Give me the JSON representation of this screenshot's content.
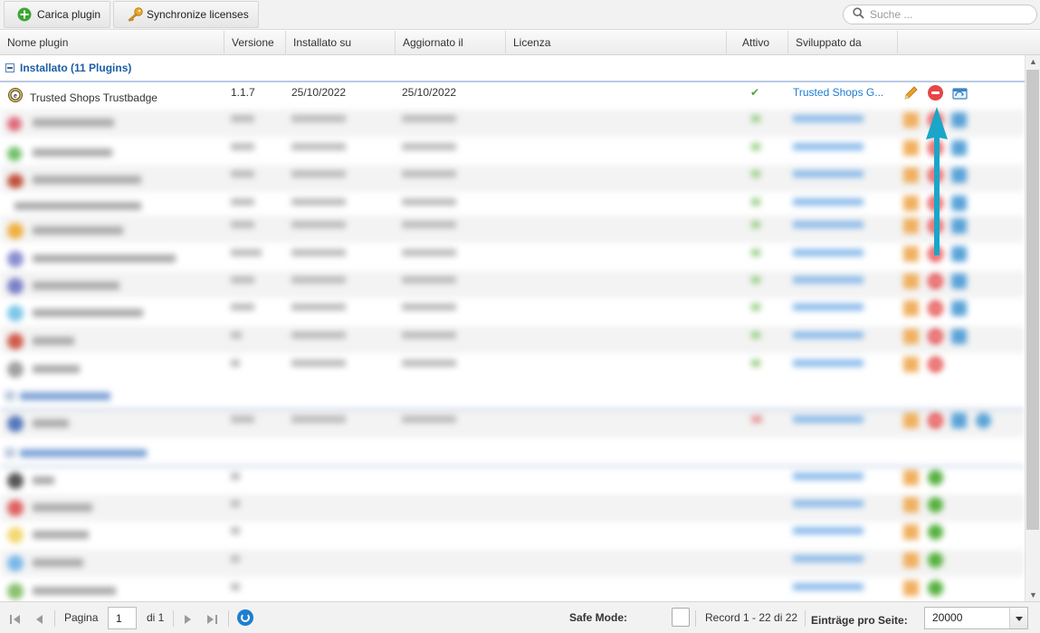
{
  "toolbar": {
    "upload_label": "Carica plugin",
    "sync_label": "Synchronize licenses",
    "search_placeholder": "Suche ..."
  },
  "columns": {
    "name": "Nome plugin",
    "version": "Versione",
    "installed": "Installato su",
    "updated": "Aggiornato il",
    "license": "Licenza",
    "active": "Attivo",
    "developer": "Sviluppato da"
  },
  "group": {
    "label": "Installato (11 Plugins)"
  },
  "first_row": {
    "name": "Trusted Shops Trustbadge",
    "version": "1.1.7",
    "installed": "25/10/2022",
    "updated": "25/10/2022",
    "active": "✔",
    "developer": "Trusted Shops G..."
  },
  "pager": {
    "page_label": "Pagina",
    "page_value": "1",
    "of_label": "di 1",
    "safe_mode_label": "Safe Mode:",
    "record_label": "Record 1 - 22 di 22",
    "per_page_label": "Einträge pro Seite:",
    "per_page_value": "20000"
  },
  "icons": {
    "add": "plus-circle-icon",
    "key": "key-icon",
    "search": "search-icon",
    "edit": "pencil-icon",
    "uninstall": "stop-icon",
    "update": "update-icon",
    "refresh": "refresh-icon"
  },
  "colors": {
    "group_text": "#1b5ea8",
    "developer_link": "#1e7bd0",
    "active_check": "#55a33a",
    "uninstall_red": "#e54646",
    "callout_arrow": "#19a6c9"
  }
}
